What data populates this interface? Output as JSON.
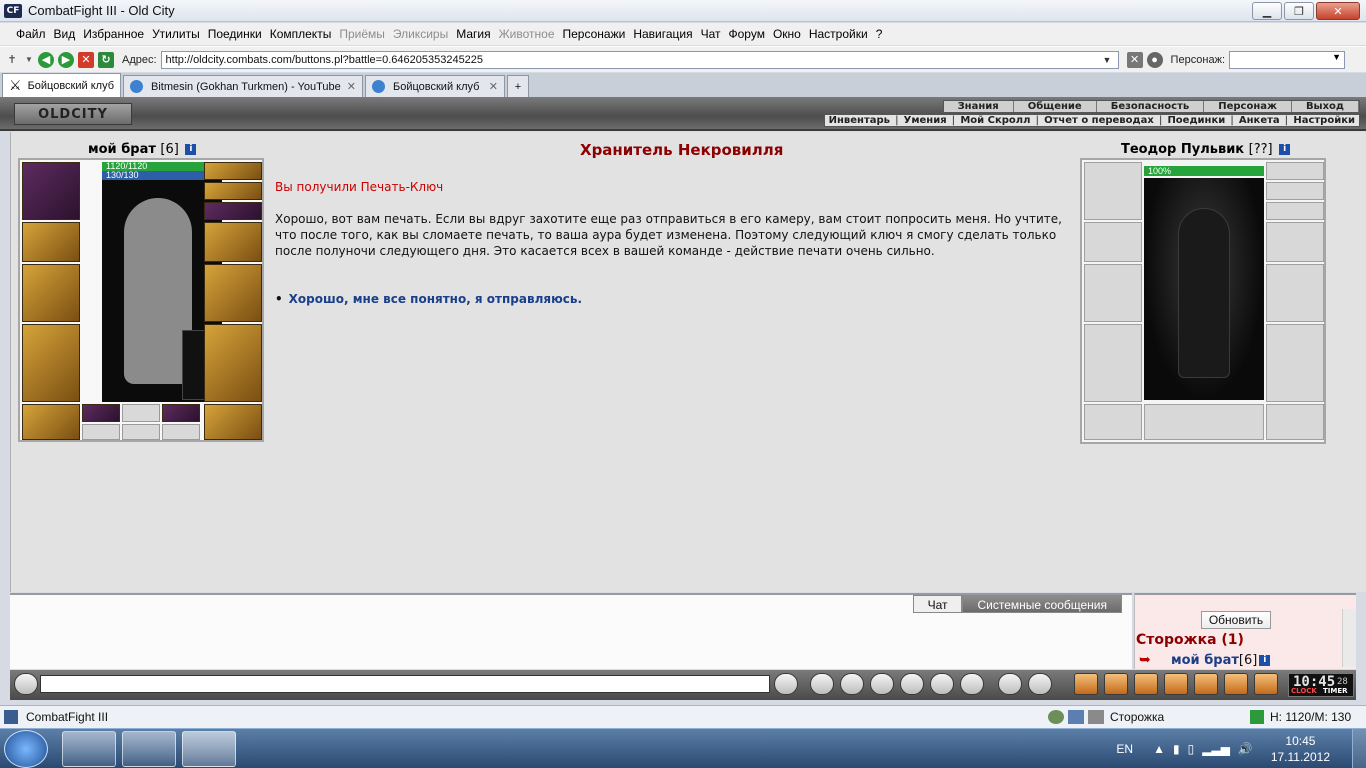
{
  "window": {
    "title": "CombatFight III - Old City",
    "app_icon": "CF"
  },
  "menu": [
    "Файл",
    "Вид",
    "Избранное",
    "Утилиты",
    "Поединки",
    "Комплекты",
    "Приёмы",
    "Эликсиры",
    "Магия",
    "Животное",
    "Персонажи",
    "Навигация",
    "Чат",
    "Форум",
    "Окно",
    "Настройки",
    "?"
  ],
  "menu_disabled": [
    "Приёмы",
    "Эликсиры",
    "Животное"
  ],
  "address": {
    "label": "Адрес:",
    "url": "http://oldcity.combats.com/buttons.pl?battle=0.646205353245225",
    "char_label": "Персонаж:"
  },
  "tabs": [
    {
      "label": "Бойцовский клуб",
      "active": true
    },
    {
      "label": "Bitmesin (Gokhan Turkmen) - YouTube",
      "active": false
    },
    {
      "label": "Бойцовский клуб",
      "active": false
    }
  ],
  "game": {
    "logo": "OLDCITY",
    "top_nav": [
      "Знания",
      "Общение",
      "Безопасность",
      "Персонаж",
      "Выход"
    ],
    "sub_nav": [
      "Инвентарь",
      "Умения",
      "Мой Скролл",
      "Отчет о переводах",
      "Поединки",
      "Анкета",
      "Настройки"
    ]
  },
  "player": {
    "name": "мой брат",
    "level": "[6]",
    "hp": "1120/1120",
    "mp": "130/130"
  },
  "npc": {
    "name": "Теодор Пульвик",
    "level": "[??]",
    "hp": "100%"
  },
  "dialog": {
    "title": "Хранитель Некровилля",
    "received": "Вы получили Печать-Ключ",
    "text": "Хорошо, вот вам печать. Если вы вдруг захотите еще раз отправиться в его камеру, вам стоит попросить меня. Но учтите, что после того, как вы сломаете печать, то ваша аура будет изменена. Поэтому следующий ключ я смогу сделать только после полуночи следующего дня. Это касается всех в вашей команде - действие печати очень сильно.",
    "answer": "Хорошо, мне все понятно, я отправляюсь."
  },
  "chat": {
    "tab_chat": "Чат",
    "tab_system": "Системные сообщения"
  },
  "online": {
    "refresh": "Обновить",
    "room": "Сторожка (1)",
    "user": "мой брат",
    "user_level": "[6]"
  },
  "clock": {
    "time": "10:45",
    "seconds": "28",
    "label_clock": "CLOCK",
    "label_timer": "TIMER"
  },
  "status": {
    "app": "CombatFight III",
    "room": "Сторожка",
    "hp_mp": "H: 1120/M: 130"
  },
  "taskbar": {
    "lang": "EN",
    "time": "10:45",
    "date": "17.11.2012"
  },
  "colors": {
    "npc_title": "#8b0000",
    "received": "#cc0000",
    "answer": "#1a3f8a"
  }
}
